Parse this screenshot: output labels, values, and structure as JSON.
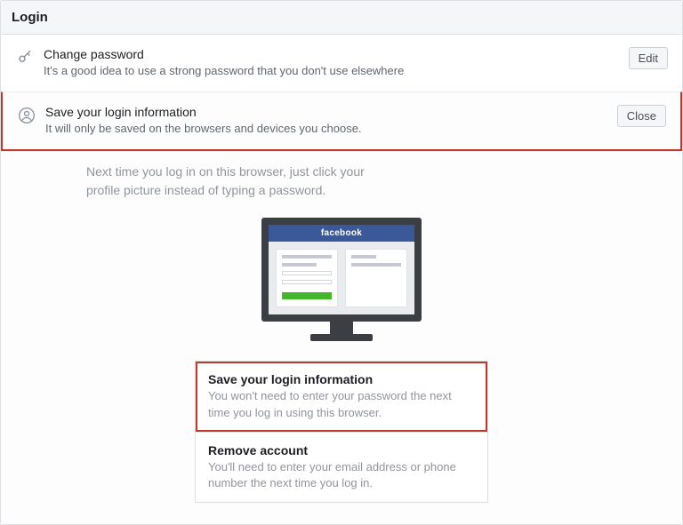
{
  "section_title": "Login",
  "change_password": {
    "title": "Change password",
    "sub": "It's a good idea to use a strong password that you don't use elsewhere",
    "action": "Edit"
  },
  "save_login": {
    "title": "Save your login information",
    "sub": "It will only be saved on the browsers and devices you choose.",
    "action": "Close",
    "next_time": "Next time you log in on this browser, just click your profile picture instead of typing a password.",
    "monitor_brand": "facebook"
  },
  "options": {
    "save": {
      "title": "Save your login information",
      "sub": "You won't need to enter your password the next time you log in using this browser."
    },
    "remove": {
      "title": "Remove account",
      "sub": "You'll need to enter your email address or phone number the next time you log in."
    }
  }
}
